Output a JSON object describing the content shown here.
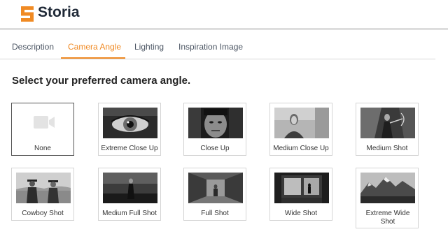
{
  "app": {
    "brand": "Storia",
    "accent_color": "#f08a24"
  },
  "tabs": [
    {
      "label": "Description",
      "active": false
    },
    {
      "label": "Camera Angle",
      "active": true
    },
    {
      "label": "Lighting",
      "active": false
    },
    {
      "label": "Inspiration Image",
      "active": false
    }
  ],
  "heading": "Select your preferred camera angle.",
  "angles": [
    {
      "label": "None",
      "selected": true,
      "icon": "video-camera-icon"
    },
    {
      "label": "Extreme Close Up",
      "selected": false
    },
    {
      "label": "Close Up",
      "selected": false
    },
    {
      "label": "Medium Close Up",
      "selected": false
    },
    {
      "label": "Medium Shot",
      "selected": false
    },
    {
      "label": "Cowboy Shot",
      "selected": false
    },
    {
      "label": "Medium Full Shot",
      "selected": false
    },
    {
      "label": "Full Shot",
      "selected": false
    },
    {
      "label": "Wide Shot",
      "selected": false
    },
    {
      "label": "Extreme Wide Shot",
      "selected": false
    }
  ]
}
